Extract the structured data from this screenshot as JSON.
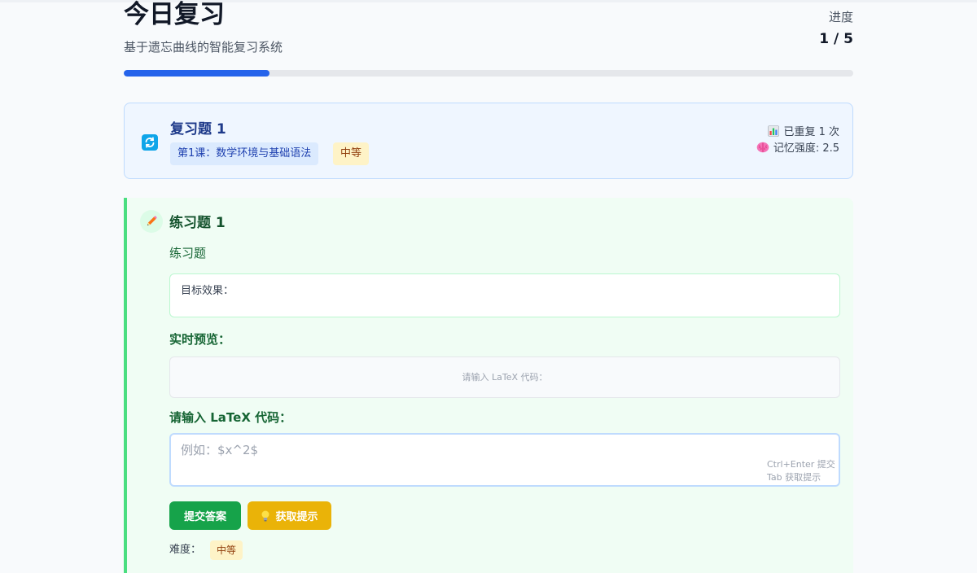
{
  "header": {
    "title": "今日复习",
    "subtitle": "基于遗忘曲线的智能复习系统",
    "progress_label": "进度",
    "progress_count": "1 / 5",
    "progress_fraction": 0.2,
    "accent_color": "#2563eb"
  },
  "review": {
    "icon": "refresh-icon",
    "title": "复习题 1",
    "lesson": "第1课：数学环境与基础语法",
    "difficulty": "中等",
    "repeat_icon": "bar-chart-icon",
    "repeat_text": "已重复 1 次",
    "memory_icon": "brain-icon",
    "memory_text": "记忆强度: 2.5"
  },
  "exercise": {
    "icon": "pencil-icon",
    "title": "练习题 1",
    "type": "练习题",
    "target_label": "目标效果：",
    "preview_heading": "实时预览：",
    "preview_placeholder": "请输入 LaTeX 代码：",
    "input_heading": "请输入 LaTeX 代码：",
    "input_placeholder": "例如：$x^2$",
    "input_value": "",
    "shortcut_submit": "Ctrl+Enter 提交",
    "shortcut_hint": "Tab 获取提示",
    "submit_label": "提交答案",
    "hint_label": "获取提示",
    "hint_icon": "lightbulb-icon",
    "difficulty_label": "难度：",
    "difficulty_value": "中等",
    "colors": {
      "submit": "#16a34a",
      "hint": "#eab308",
      "card_border": "#4ade80"
    }
  }
}
